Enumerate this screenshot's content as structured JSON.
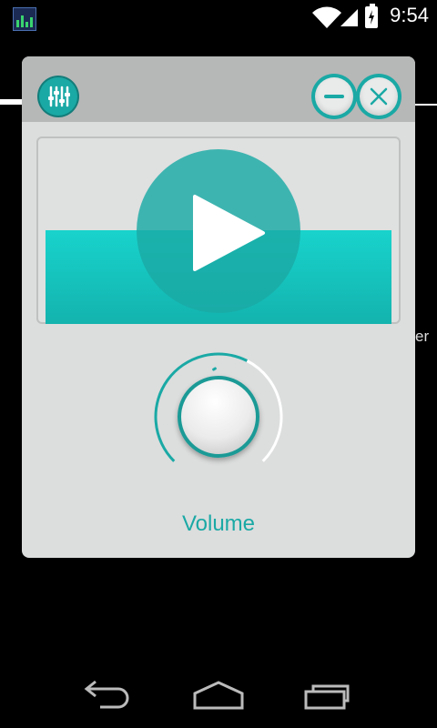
{
  "status_bar": {
    "time": "9:54",
    "icons": [
      "equalizer-app-icon",
      "wifi-icon",
      "signal-icon",
      "battery-charging-icon"
    ]
  },
  "background": {
    "partial_text": "er"
  },
  "panel": {
    "header_buttons": {
      "equalizer": "equalizer-icon",
      "minimize": "minimize-icon",
      "close": "close-icon"
    },
    "player": {
      "play_icon": "play-icon"
    },
    "volume": {
      "label": "Volume",
      "level": 0.6
    }
  },
  "nav_bar": {
    "icons": [
      "back-icon",
      "home-icon",
      "recent-apps-icon"
    ]
  },
  "colors": {
    "accent": "#1aa9a5",
    "teal_bar": "#18d3cc",
    "panel_bg": "#dcdddd",
    "header_bg": "#b6b7b7"
  }
}
